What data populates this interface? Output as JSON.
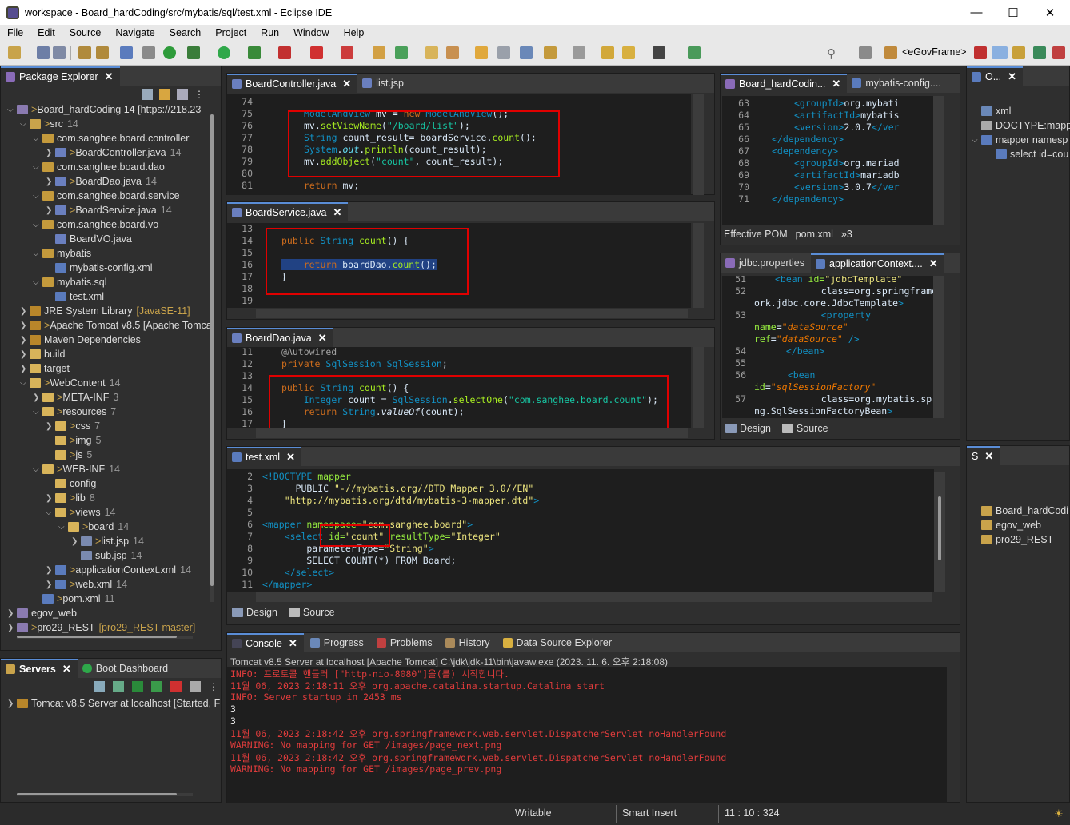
{
  "window": {
    "title": "workspace - Board_hardCoding/src/mybatis/sql/test.xml - Eclipse IDE"
  },
  "menu": [
    "File",
    "Edit",
    "Source",
    "Navigate",
    "Search",
    "Project",
    "Run",
    "Window",
    "Help"
  ],
  "toolbar": {
    "perspective_label": "<eGovFrame>"
  },
  "package_explorer": {
    "tab": "Package Explorer",
    "items": [
      {
        "label": "Board_hardCoding 14 [https://218.23",
        "icon": "project-icon"
      },
      {
        "label": "src",
        "count": "14",
        "icon": "src-folder-icon"
      },
      {
        "label": "com.sanghee.board.controller",
        "icon": "package-icon"
      },
      {
        "label": "BoardController.java",
        "count": "14",
        "icon": "java-file-icon"
      },
      {
        "label": "com.sanghee.board.dao",
        "icon": "package-icon"
      },
      {
        "label": "BoardDao.java",
        "count": "14",
        "icon": "java-file-icon"
      },
      {
        "label": "com.sanghee.board.service",
        "icon": "package-icon"
      },
      {
        "label": "BoardService.java",
        "count": "14",
        "icon": "java-file-icon"
      },
      {
        "label": "com.sanghee.board.vo",
        "icon": "package-icon"
      },
      {
        "label": "BoardVO.java",
        "icon": "java-file-icon"
      },
      {
        "label": "mybatis",
        "icon": "package-icon"
      },
      {
        "label": "mybatis-config.xml",
        "icon": "xml-file-icon"
      },
      {
        "label": "mybatis.sql",
        "icon": "package-icon"
      },
      {
        "label": "test.xml",
        "icon": "xml-file-icon"
      },
      {
        "label": "JRE System Library",
        "extra": "[JavaSE-11]",
        "icon": "library-icon"
      },
      {
        "label": "Apache Tomcat v8.5 [Apache Tomca",
        "icon": "library-icon"
      },
      {
        "label": "Maven Dependencies",
        "icon": "library-icon"
      },
      {
        "label": "build",
        "icon": "folder-icon"
      },
      {
        "label": "target",
        "icon": "folder-icon"
      },
      {
        "label": "WebContent",
        "count": "14",
        "icon": "folder-icon"
      },
      {
        "label": "META-INF",
        "count": "3",
        "icon": "folder-icon"
      },
      {
        "label": "resources",
        "count": "7",
        "icon": "folder-icon"
      },
      {
        "label": "css",
        "count": "7",
        "icon": "folder-icon"
      },
      {
        "label": "img",
        "count": "5",
        "icon": "folder-icon"
      },
      {
        "label": "js",
        "count": "5",
        "icon": "folder-icon"
      },
      {
        "label": "WEB-INF",
        "count": "14",
        "icon": "folder-icon"
      },
      {
        "label": "config",
        "icon": "folder-icon"
      },
      {
        "label": "lib",
        "count": "8",
        "icon": "folder-icon"
      },
      {
        "label": "views",
        "count": "14",
        "icon": "folder-icon"
      },
      {
        "label": "board",
        "count": "14",
        "icon": "folder-icon"
      },
      {
        "label": "list.jsp",
        "count": "14",
        "icon": "jsp-file-icon"
      },
      {
        "label": "sub.jsp",
        "count": "14",
        "icon": "jsp-file-icon"
      },
      {
        "label": "applicationContext.xml",
        "count": "14",
        "icon": "xml-file-icon"
      },
      {
        "label": "web.xml",
        "count": "14",
        "icon": "xml-file-icon"
      },
      {
        "label": "pom.xml",
        "count": "11",
        "icon": "xml-file-icon"
      },
      {
        "label": "egov_web",
        "icon": "project-icon"
      },
      {
        "label": "pro29_REST",
        "extra": "[pro29_REST master]",
        "icon": "project-icon"
      }
    ]
  },
  "servers": {
    "tab": "Servers",
    "tab2": "Boot Dashboard",
    "item": "Tomcat v8.5 Server at localhost  [Started, F"
  },
  "editor_controller": {
    "tabs": [
      "BoardController.java",
      "list.jsp"
    ],
    "lines": [
      "74",
      "75",
      "76",
      "77",
      "78",
      "79",
      "80",
      "81"
    ],
    "code": [
      "",
      "ModelAndView mv = new ModelAndView();",
      "mv.setViewName(\"/board/list\");",
      "String count_result= boardService.count();",
      "System.out.println(count_result);",
      "mv.addObject(\"count\", count_result);",
      "",
      "return mv;"
    ]
  },
  "editor_service": {
    "tab": "BoardService.java",
    "lines": [
      "13",
      "14",
      "15",
      "16",
      "17",
      "18",
      "19"
    ],
    "code": [
      "",
      "public String count() {",
      "",
      "    return boardDao.count();",
      "}",
      "",
      ""
    ]
  },
  "editor_dao": {
    "tab": "BoardDao.java",
    "lines": [
      "11",
      "12",
      "13",
      "14",
      "15",
      "16",
      "17"
    ],
    "code": [
      "@Autowired",
      "private SqlSession SqlSession;",
      "",
      "public String count() {",
      "    Integer count = SqlSession.selectOne(\"com.sanghee.board.count\");",
      "    return String.valueOf(count);",
      "}"
    ]
  },
  "editor_test": {
    "tab": "test.xml",
    "lines": [
      "2",
      "3",
      "4",
      "5",
      "6",
      "7",
      "8",
      "9",
      "10",
      "11"
    ],
    "code": [
      "<!DOCTYPE mapper",
      "      PUBLIC \"-//mybatis.org//DTD Mapper 3.0//EN\"",
      "    \"http://mybatis.org/dtd/mybatis-3-mapper.dtd\">",
      "",
      "<mapper namespace=\"com.sanghee.board\">",
      "    <select id=\"count\" resultType=\"Integer\"",
      "        parameterType=\"String\">",
      "        SELECT COUNT(*) FROM Board;",
      "    </select>",
      "</mapper>"
    ],
    "bottom_tabs": [
      "Design",
      "Source"
    ]
  },
  "editor_pom": {
    "tabs": [
      "Board_hardCodin...",
      "mybatis-config...."
    ],
    "lines": [
      "63",
      "64",
      "65",
      "66",
      "67",
      "68",
      "69",
      "70",
      "71"
    ],
    "code": [
      "<groupId>org.mybati",
      "<artifactId>mybatis",
      "<version>2.0.7</ver",
      "</dependency>",
      "<dependency>",
      "<groupId>org.mariad",
      "<artifactId>mariadb",
      "<version>3.0.7</ver",
      "</dependency>"
    ],
    "bottom_tabs": [
      "Effective POM",
      "pom.xml",
      "»3"
    ]
  },
  "editor_appctx": {
    "tabs": [
      "jdbc.properties",
      "applicationContext...."
    ],
    "lines": [
      "51",
      "52",
      "",
      "53",
      "",
      "",
      "54",
      "55",
      "56",
      "",
      "57",
      ""
    ],
    "code": [
      "<bean id=\"jdbcTemplate\"",
      "    class=\"org.springframew",
      "ork.jdbc.core.JdbcTemplate\">",
      "    <property",
      "name=\"dataSource\"",
      "ref=\"dataSource\" />",
      "  </bean>",
      "",
      "  <bean",
      "id=\"sqlSessionFactory\"",
      "    class=\"org.mybatis.spri",
      "ng.SqlSessionFactoryBean\">"
    ],
    "bottom_tabs": [
      "Design",
      "Source"
    ]
  },
  "outline": {
    "tab": "O...",
    "items": [
      "xml",
      "DOCTYPE:mapp",
      "mapper namesp",
      "select id=cou"
    ]
  },
  "servers_right": {
    "tab": "S",
    "items": [
      "Board_hardCodi",
      "egov_web",
      "pro29_REST"
    ]
  },
  "console": {
    "tabs": [
      "Console",
      "Progress",
      "Problems",
      "History",
      "Data Source Explorer"
    ],
    "header": "Tomcat v8.5 Server at localhost [Apache Tomcat] C:\\jdk\\jdk-11\\bin\\javaw.exe  (2023. 11. 6. 오후 2:18:08)",
    "lines": [
      {
        "t": "INFO: 프로토콜 핸들러 [\"http-nio-8080\"]을(를) 시작합니다.",
        "c": "#e03c3c"
      },
      {
        "t": "11월 06, 2023 2:18:11 오후 org.apache.catalina.startup.Catalina start",
        "c": "#e03c3c"
      },
      {
        "t": "INFO: Server startup in 2453 ms",
        "c": "#e03c3c"
      },
      {
        "t": "3",
        "c": "#e8e8e8"
      },
      {
        "t": "3",
        "c": "#e8e8e8"
      },
      {
        "t": "11월 06, 2023 2:18:42 오후 org.springframework.web.servlet.DispatcherServlet noHandlerFound",
        "c": "#e03c3c"
      },
      {
        "t": "WARNING: No mapping for GET /images/page_next.png",
        "c": "#e03c3c"
      },
      {
        "t": "11월 06, 2023 2:18:42 오후 org.springframework.web.servlet.DispatcherServlet noHandlerFound",
        "c": "#e03c3c"
      },
      {
        "t": "WARNING: No mapping for GET /images/page_prev.png",
        "c": "#e03c3c"
      }
    ]
  },
  "status": {
    "mode": "Writable",
    "insert": "Smart Insert",
    "position": "11 : 10 : 324"
  }
}
